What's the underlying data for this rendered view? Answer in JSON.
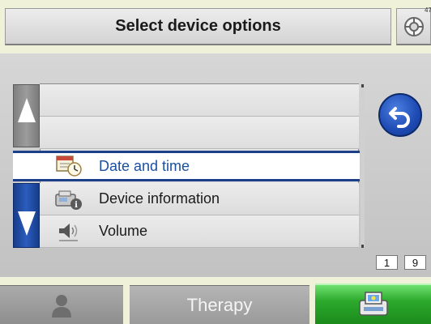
{
  "header": {
    "title": "Select device options",
    "help_number": "47"
  },
  "list": {
    "items": [
      {
        "label": "Date and time",
        "icon": "calendar-clock-icon",
        "selected": true
      },
      {
        "label": "Device information",
        "icon": "device-info-icon",
        "selected": false
      },
      {
        "label": "Volume",
        "icon": "speaker-icon",
        "selected": false
      }
    ]
  },
  "pagination": {
    "current": "1",
    "total": "9"
  },
  "tabs": {
    "user_icon": "user-silhouette-icon",
    "therapy_label": "Therapy",
    "device_icon": "device-icon"
  },
  "colors": {
    "accent_blue": "#1c3f8a",
    "selected_text": "#1b4fa0",
    "active_tab_green": "#2daa2d",
    "background": "#eff1d8"
  }
}
